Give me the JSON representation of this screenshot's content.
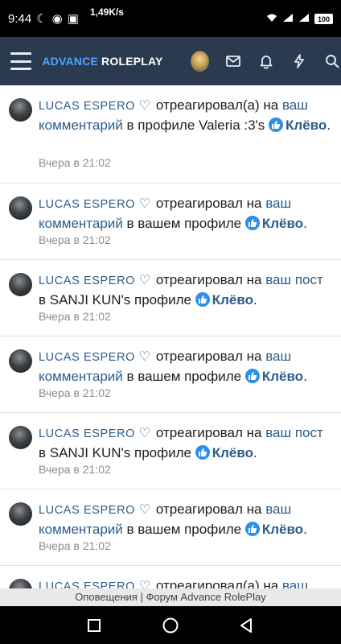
{
  "status": {
    "time": "9:44",
    "speed": "1,49K/s",
    "battery": "100"
  },
  "header": {
    "logo_part1": "ADVANCE ",
    "logo_part2": "ROLEPLAY",
    "icons": [
      "menu-icon",
      "user-avatar",
      "mail-icon",
      "bell-icon",
      "bolt-icon",
      "search-icon"
    ]
  },
  "notifications": [
    {
      "user": "LUCAS ESPERO",
      "heart": "♡",
      "action": "отреагировал(а) на",
      "link": "ваш комментарий",
      "context": "в профиле Valeria :3's",
      "reaction": "Клёво",
      "time": "Вчера в 21:02"
    },
    {
      "user": "LUCAS ESPERO",
      "heart": "♡",
      "action": "отреагировал на",
      "link": "ваш комментарий",
      "context": "в вашем профиле",
      "reaction": "Клёво",
      "time": "Вчера в 21:02"
    },
    {
      "user": "LUCAS ESPERO",
      "heart": "♡",
      "action": "отреагировал на",
      "link": "ваш пост",
      "context": "в SANJI KUN's профиле",
      "reaction": "Клёво",
      "time": "Вчера в 21:02"
    },
    {
      "user": "LUCAS ESPERO",
      "heart": "♡",
      "action": "отреагировал на",
      "link": "ваш комментарий",
      "context": "в вашем профиле",
      "reaction": "Клёво",
      "time": "Вчера в 21:02"
    },
    {
      "user": "LUCAS ESPERO",
      "heart": "♡",
      "action": "отреагировал на",
      "link": "ваш пост",
      "context": "в SANJI KUN's профиле",
      "reaction": "Клёво",
      "time": "Вчера в 21:02"
    },
    {
      "user": "LUCAS ESPERO",
      "heart": "♡",
      "action": "отреагировал на",
      "link": "ваш комментарий",
      "context": "в вашем профиле",
      "reaction": "Клёво",
      "time": "Вчера в 21:02"
    },
    {
      "user": "LUCAS ESPERO",
      "heart": "♡",
      "action": "отреагировал(а) на",
      "link": "ваш",
      "context": "",
      "reaction": "",
      "time": ""
    }
  ],
  "footer": {
    "page_title": "Оповещения | Форум Advance RolePlay"
  },
  "colors": {
    "header_bg": "#2a3b50",
    "link": "#2b5c8a",
    "like_badge": "#2f8ee6"
  }
}
